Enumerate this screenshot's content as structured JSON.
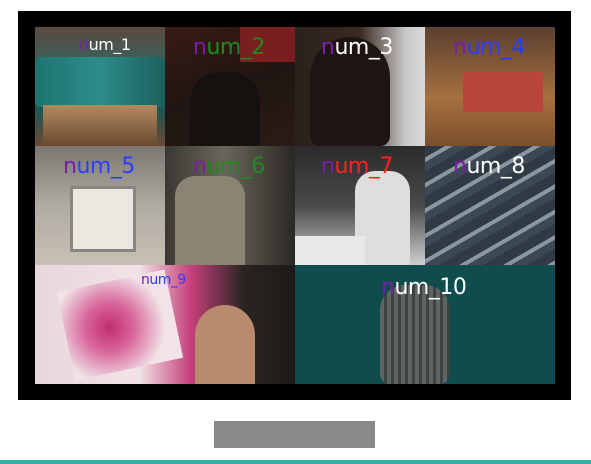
{
  "tiles": [
    {
      "label": "num_1",
      "first_color": "#7a1ea8",
      "rest_color": "#ffffff"
    },
    {
      "label": "num_2",
      "first_color": "#7a1ea8",
      "rest_color": "#1f8a1f"
    },
    {
      "label": "num_3",
      "first_color": "#7a1ea8",
      "rest_color": "#ffffff"
    },
    {
      "label": "num_4",
      "first_color": "#7a1ea8",
      "rest_color": "#2a3cff"
    },
    {
      "label": "num_5",
      "first_color": "#7a1ea8",
      "rest_color": "#2a3cff"
    },
    {
      "label": "num_6",
      "first_color": "#7a1ea8",
      "rest_color": "#1f8a1f"
    },
    {
      "label": "num_7",
      "first_color": "#7a1ea8",
      "rest_color": "#ff2020"
    },
    {
      "label": "num_8",
      "first_color": "#7a1ea8",
      "rest_color": "#ffffff"
    },
    {
      "label": "num_9",
      "first_color": "#7a1ea8",
      "rest_color": "#2a3cff"
    },
    {
      "label": "num_10",
      "first_color": "#7a1ea8",
      "rest_color": "#ffffff"
    }
  ]
}
